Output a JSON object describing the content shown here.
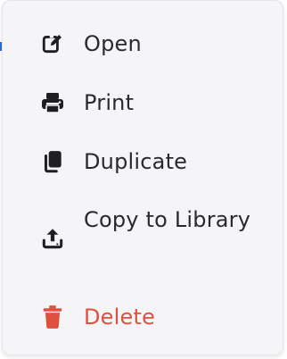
{
  "menu": {
    "items": [
      {
        "id": "open",
        "label": "Open",
        "icon": "edit-icon"
      },
      {
        "id": "print",
        "label": "Print",
        "icon": "printer-icon"
      },
      {
        "id": "duplicate",
        "label": "Duplicate",
        "icon": "copy-icon"
      },
      {
        "id": "copy_to_library",
        "label": "Copy to Library",
        "icon": "upload-icon"
      },
      {
        "id": "delete",
        "label": "Delete",
        "icon": "trash-icon"
      }
    ]
  },
  "colors": {
    "text": "#2a2a2e",
    "icon": "#1f1f22",
    "danger": "#e0503f",
    "menu_bg": "#f5f5f8"
  }
}
